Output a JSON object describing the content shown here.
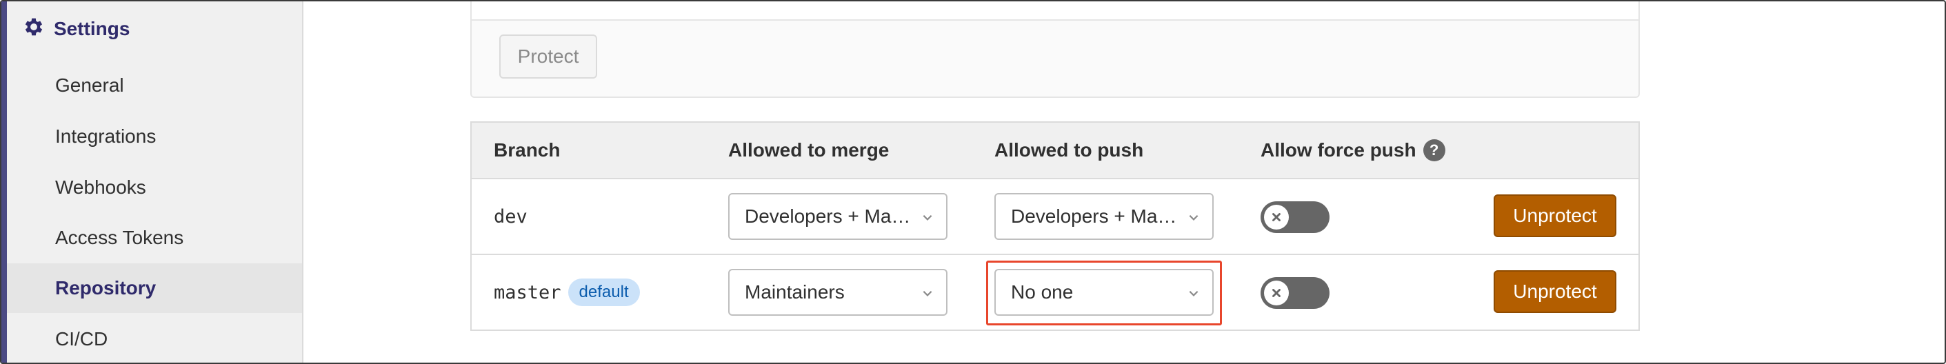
{
  "sidebar": {
    "header": "Settings",
    "items": [
      {
        "label": "General"
      },
      {
        "label": "Integrations"
      },
      {
        "label": "Webhooks"
      },
      {
        "label": "Access Tokens"
      },
      {
        "label": "Repository",
        "active": true
      },
      {
        "label": "CI/CD"
      }
    ]
  },
  "protect_panel": {
    "button_label": "Protect"
  },
  "table": {
    "headers": {
      "branch": "Branch",
      "merge": "Allowed to merge",
      "push": "Allowed to push",
      "force": "Allow force push"
    },
    "help_icon_glyph": "?",
    "rows": [
      {
        "branch": "dev",
        "badge": "",
        "merge": "Developers + Ma…",
        "push": "Developers + Ma…",
        "force_push": false,
        "action": "Unprotect"
      },
      {
        "branch": "master",
        "badge": "default",
        "merge": "Maintainers",
        "push": "No one",
        "force_push": false,
        "action": "Unprotect"
      }
    ]
  },
  "colors": {
    "accent": "#4b4a84",
    "unprotect": "#b35e00",
    "highlight": "#e8462c",
    "badge_bg": "#cbe2f9"
  }
}
